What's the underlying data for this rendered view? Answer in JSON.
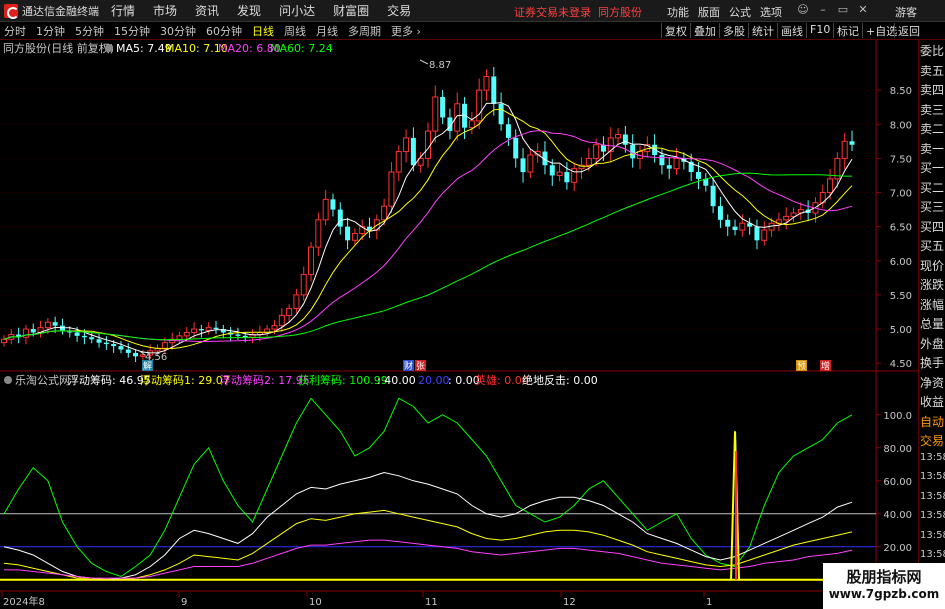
{
  "titlebar": {
    "app_name": "通达信金融终端",
    "menus": [
      "行情",
      "市场",
      "资讯",
      "发现",
      "问小达",
      "财富圈",
      "交易"
    ],
    "notice": "证券交易未登录",
    "stock_short": "同方股份",
    "right_menus": [
      "功能",
      "版面",
      "公式",
      "选项"
    ],
    "guest": "游客"
  },
  "periodbar": {
    "items": [
      "分时",
      "1分钟",
      "5分钟",
      "15分钟",
      "30分钟",
      "60分钟",
      "日线",
      "周线",
      "月线",
      "多周期",
      "更多"
    ],
    "active": "日线",
    "tools": [
      "复权",
      "叠加",
      "多股",
      "统计",
      "画线",
      "F10",
      "标记",
      "+自选",
      "返回"
    ]
  },
  "main_panel": {
    "stock_label": "同方股份(日线 前复权)",
    "ma_labels": [
      {
        "text": "MA5: 7.49",
        "color": "#ffffff"
      },
      {
        "text": "MA10: 7.10",
        "color": "#ffff00"
      },
      {
        "text": "MA20: 6.80",
        "color": "#ff40ff"
      },
      {
        "text": "MA60: 7.24",
        "color": "#00ff00"
      }
    ],
    "high_label": "8.87",
    "low_label": "4.56",
    "price_ticks": [
      "8.50",
      "8.00",
      "7.50",
      "7.00",
      "6.50",
      "6.00",
      "5.50",
      "5.00",
      "4.50"
    ],
    "markers": [
      {
        "text": "财",
        "bg": "#3050d0"
      },
      {
        "text": "张",
        "bg": "#d02020"
      },
      {
        "text": "预",
        "bg": "#d09000"
      },
      {
        "text": "增",
        "bg": "#d02020"
      },
      {
        "text": "解",
        "bg": "#2080a0"
      }
    ]
  },
  "indicator_panel": {
    "name": "乐淘公式网",
    "values": [
      {
        "text": "浮动筹码: 46.95",
        "color": "#ffffff"
      },
      {
        "text": "浮动筹码1: 29.07",
        "color": "#ffff00"
      },
      {
        "text": "浮动筹码2: 17.95",
        "color": "#ff40ff"
      },
      {
        "text": "获利筹码: 100.99",
        "color": "#00ff00"
      },
      {
        "text": ": 40.00",
        "color": "#ffffff"
      },
      {
        "text": "20.00",
        "color": "#4040ff"
      },
      {
        "text": ": 0.00",
        "color": "#ffffff"
      },
      {
        "text": "英雄: 0.00",
        "color": "#ff3030"
      },
      {
        "text": "绝地反击: 0.00",
        "color": "#ffffff"
      }
    ],
    "ticks": [
      "100.0",
      "80.00",
      "60.00",
      "40.00",
      "20.00"
    ]
  },
  "date_axis": [
    "2024年8",
    "9",
    "10",
    "11",
    "12",
    "1"
  ],
  "sidepanel": {
    "items": [
      "委比",
      "卖五",
      "卖四",
      "卖三",
      "卖二",
      "卖一",
      "买一",
      "买二",
      "买三",
      "买四",
      "买五",
      "现价",
      "涨跌",
      "涨幅",
      "总量",
      "外盘",
      "换手",
      "净资",
      "收益",
      "自动",
      "交易",
      "13:58",
      "13:58",
      "13:58",
      "13:58",
      "13:58",
      "13:58",
      "13:58",
      "13:58"
    ]
  },
  "watermark": {
    "line1": "股朋指标网",
    "line2": "www.7gpzb.com"
  },
  "chart_data": [
    {
      "type": "candlestick",
      "title": "同方股份(日线 前复权)",
      "ylim": [
        4.4,
        9.0
      ],
      "y_ticks": [
        4.5,
        5.0,
        5.5,
        6.0,
        6.5,
        7.0,
        7.5,
        8.0,
        8.5
      ],
      "annotations": [
        {
          "text": "8.87",
          "value": 8.87
        },
        {
          "text": "4.56",
          "value": 4.56
        }
      ],
      "closes": [
        4.85,
        4.92,
        4.88,
        5.0,
        4.95,
        5.02,
        5.1,
        5.05,
        4.98,
        4.95,
        4.9,
        4.88,
        4.85,
        4.8,
        4.78,
        4.75,
        4.7,
        4.65,
        4.6,
        4.62,
        4.68,
        4.72,
        4.8,
        4.85,
        4.9,
        4.95,
        5.0,
        4.98,
        5.02,
        5.0,
        4.95,
        4.92,
        4.9,
        4.88,
        4.92,
        4.95,
        5.0,
        5.05,
        5.2,
        5.3,
        5.5,
        5.8,
        6.2,
        6.6,
        6.9,
        6.75,
        6.5,
        6.3,
        6.4,
        6.5,
        6.45,
        6.6,
        6.8,
        7.3,
        7.6,
        7.8,
        7.4,
        7.5,
        7.9,
        8.4,
        8.1,
        7.9,
        8.3,
        7.95,
        8.05,
        8.5,
        8.7,
        8.3,
        8.0,
        7.8,
        7.5,
        7.3,
        7.55,
        7.6,
        7.4,
        7.25,
        7.3,
        7.15,
        7.35,
        7.4,
        7.5,
        7.7,
        7.6,
        7.8,
        7.85,
        7.7,
        7.5,
        7.6,
        7.7,
        7.55,
        7.4,
        7.35,
        7.5,
        7.45,
        7.3,
        7.2,
        7.1,
        6.8,
        6.6,
        6.5,
        6.45,
        6.55,
        6.5,
        6.3,
        6.45,
        6.55,
        6.6,
        6.65,
        6.7,
        6.75,
        6.7,
        6.85,
        7.0,
        7.2,
        7.5,
        7.75,
        7.7
      ],
      "series": [
        {
          "name": "MA5",
          "color": "#ffffff",
          "last": 7.49
        },
        {
          "name": "MA10",
          "color": "#ffff00",
          "last": 7.1
        },
        {
          "name": "MA20",
          "color": "#ff40ff",
          "last": 6.8
        },
        {
          "name": "MA60",
          "color": "#00ff00",
          "last": 7.24
        }
      ]
    },
    {
      "type": "line",
      "title": "乐淘公式网",
      "ylim": [
        -5,
        115
      ],
      "y_ticks": [
        20,
        40,
        60,
        80,
        100
      ],
      "reference_lines": [
        {
          "value": 40,
          "color": "#c0c0c0"
        },
        {
          "value": 20,
          "color": "#3030ff"
        },
        {
          "value": 0,
          "color": "#ffff00"
        }
      ],
      "series": [
        {
          "name": "获利筹码",
          "color": "#00ff00",
          "values": [
            40,
            55,
            68,
            60,
            35,
            20,
            10,
            5,
            2,
            8,
            15,
            30,
            50,
            70,
            80,
            60,
            45,
            35,
            55,
            75,
            95,
            110,
            100,
            90,
            75,
            80,
            90,
            110,
            105,
            95,
            100,
            95,
            85,
            75,
            60,
            45,
            40,
            35,
            38,
            45,
            55,
            60,
            50,
            40,
            30,
            35,
            40,
            25,
            15,
            10,
            8,
            20,
            45,
            65,
            75,
            80,
            85,
            95,
            100
          ]
        },
        {
          "name": "浮动筹码",
          "color": "#ffffff",
          "values": [
            20,
            18,
            15,
            10,
            5,
            2,
            1,
            0,
            1,
            3,
            8,
            15,
            25,
            30,
            28,
            25,
            22,
            28,
            38,
            45,
            52,
            56,
            55,
            58,
            60,
            62,
            65,
            63,
            60,
            58,
            55,
            52,
            45,
            40,
            38,
            40,
            45,
            48,
            50,
            50,
            48,
            45,
            40,
            35,
            28,
            25,
            22,
            18,
            14,
            12,
            14,
            18,
            22,
            26,
            30,
            34,
            38,
            44,
            47
          ]
        },
        {
          "name": "浮动筹码1",
          "color": "#ffff00",
          "values": [
            10,
            9,
            7,
            5,
            3,
            1,
            1,
            0,
            0,
            1,
            3,
            6,
            10,
            15,
            14,
            13,
            12,
            16,
            22,
            28,
            34,
            37,
            36,
            38,
            40,
            41,
            42,
            40,
            38,
            36,
            34,
            32,
            28,
            25,
            24,
            25,
            27,
            29,
            30,
            30,
            29,
            27,
            24,
            21,
            17,
            15,
            13,
            11,
            9,
            8,
            9,
            12,
            15,
            18,
            21,
            23,
            25,
            27,
            29
          ]
        },
        {
          "name": "浮动筹码2",
          "color": "#ff40ff",
          "values": [
            6,
            6,
            5,
            4,
            3,
            2,
            1,
            1,
            1,
            1,
            2,
            4,
            6,
            8,
            8,
            8,
            8,
            10,
            13,
            16,
            19,
            21,
            21,
            22,
            23,
            24,
            24,
            23,
            22,
            21,
            20,
            19,
            17,
            16,
            15,
            16,
            17,
            18,
            19,
            19,
            18,
            17,
            16,
            14,
            12,
            10,
            9,
            8,
            7,
            6,
            7,
            8,
            10,
            11,
            12,
            14,
            15,
            16,
            18
          ]
        },
        {
          "name": "绝地反击",
          "color": "#ffff00",
          "values": [
            0,
            0,
            0,
            0,
            0,
            0,
            0,
            0,
            0,
            0,
            0,
            0,
            0,
            0,
            0,
            0,
            0,
            0,
            0,
            0,
            0,
            0,
            0,
            0,
            0,
            0,
            0,
            0,
            0,
            0,
            0,
            0,
            0,
            0,
            0,
            0,
            0,
            0,
            0,
            0,
            0,
            0,
            0,
            0,
            0,
            0,
            0,
            0,
            0,
            0,
            90,
            0,
            0,
            0,
            0,
            0,
            0,
            0,
            0
          ]
        }
      ]
    }
  ]
}
